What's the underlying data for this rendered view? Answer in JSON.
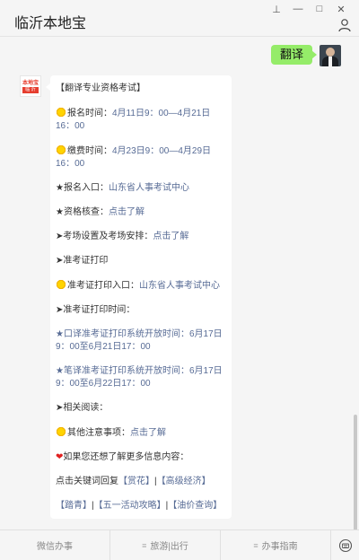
{
  "window": {
    "title": "临沂本地宝",
    "controls": {
      "pin": "⊥",
      "minimize": "—",
      "maximize": "□",
      "close": "✕"
    }
  },
  "outgoing": {
    "text": "翻译"
  },
  "bot_avatar": {
    "logo_top": "本地宝",
    "logo_bottom": "临 沂"
  },
  "message": {
    "heading": "【翻译专业资格考试】",
    "reg_time": {
      "label": "报名时间：",
      "value": "4月11日9：00—4月21日16：00"
    },
    "pay_time": {
      "label": "缴费时间：",
      "value": "4月23日9：00—4月29日16：00"
    },
    "reg_entry": {
      "label": "★报名入口：",
      "link": "山东省人事考试中心"
    },
    "qual_check": {
      "label": "★资格核查：",
      "link": "点击了解"
    },
    "venue": {
      "label": "➤考场设置及考场安排：",
      "link": "点击了解"
    },
    "print_heading": "➤准考证打印",
    "print_entry": {
      "label": "准考证打印入口：",
      "link": "山东省人事考试中心"
    },
    "print_time_heading": "➤准考证打印时间：",
    "oral_print": "★口译准考证打印系统开放时间：6月17日9：00至6月21日17：00",
    "written_print": "★笔译准考证打印系统开放时间：6月17日9：00至6月22日17：00",
    "related": "➤相关阅读：",
    "other": {
      "label": "其他注意事项：",
      "link": "点击了解"
    },
    "more": "如果您还想了解更多信息内容：",
    "keywords_intro": "点击关键词回复",
    "kw_shanghua": "【赏花】",
    "kw_gaoji": "【高级经济】",
    "kw_taqing": "【踏青】",
    "kw_wuyi": "【五一活动攻略】",
    "kw_youjia": "【油价查询】",
    "sep": "|"
  },
  "bottom_menu": {
    "items": [
      {
        "label": "微信办事"
      },
      {
        "label": "旅游|出行"
      },
      {
        "label": "办事指南"
      }
    ],
    "menu_glyph": "≡"
  },
  "colors": {
    "link": "#576b95",
    "outgoing_bubble": "#95ec69",
    "brand": "#e63d2e"
  }
}
